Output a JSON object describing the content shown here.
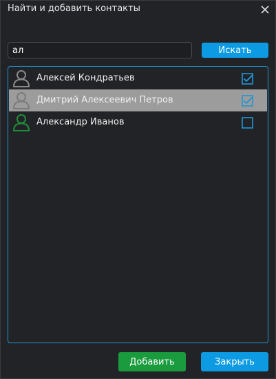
{
  "dialog": {
    "title": "Найти и добавить контакты"
  },
  "search": {
    "value": "ал",
    "button_label": "Искать"
  },
  "contacts": [
    {
      "name": "Алексей Кондратьев",
      "checked": true,
      "selected": false,
      "status_color": "#8a8a8a"
    },
    {
      "name": "Дмитрий Алексеевич Петров",
      "checked": true,
      "selected": true,
      "status_color": "#7a7a7a"
    },
    {
      "name": "Александр Иванов",
      "checked": false,
      "selected": false,
      "status_color": "#1f8f3a"
    }
  ],
  "footer": {
    "add_label": "Добавить",
    "close_label": "Закрыть"
  },
  "colors": {
    "accent": "#0c9be3",
    "add_button": "#1a9b3e",
    "selected_row": "#9c9c9c",
    "list_border": "#2096d6"
  }
}
